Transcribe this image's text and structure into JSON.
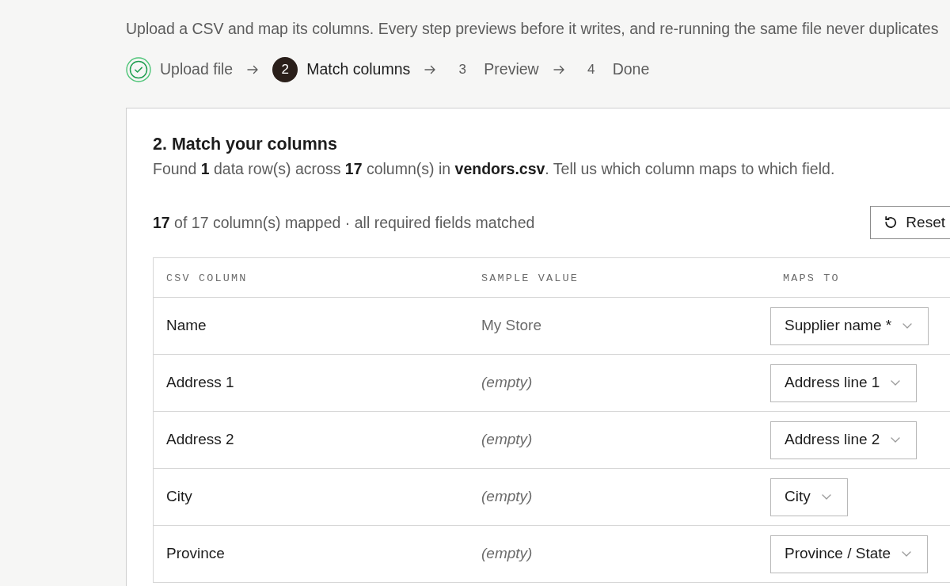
{
  "intro": "Upload a CSV and map its columns. Every step previews before it writes, and re-running the same file never duplicates",
  "steps": [
    {
      "label": "Upload file",
      "completed": true,
      "selected": false
    },
    {
      "number": "2",
      "label": "Match columns",
      "completed": false,
      "selected": true
    },
    {
      "number": "3",
      "label": "Preview",
      "completed": false,
      "selected": false
    },
    {
      "number": "4",
      "label": "Done",
      "completed": false,
      "selected": false
    }
  ],
  "card": {
    "heading": "2. Match your columns",
    "description": "Found **1** data row(s) across **17** column(s) in **vendors.csv**. Tell us which column maps to which field.",
    "summary": "**17** of 17 column(s) mapped · all required fields matched",
    "reset_button": {
      "label": "Reset"
    },
    "table": {
      "columns": [
        "CSV COLUMN",
        "SAMPLE VALUE",
        "MAPS TO"
      ],
      "rows": [
        {
          "column": "Name",
          "sample": "My Store",
          "sample_empty": false,
          "maps_to": "Supplier name *"
        },
        {
          "column": "Address 1",
          "sample": "(empty)",
          "sample_empty": true,
          "maps_to": "Address line 1"
        },
        {
          "column": "Address 2",
          "sample": "(empty)",
          "sample_empty": true,
          "maps_to": "Address line 2"
        },
        {
          "column": "City",
          "sample": "(empty)",
          "sample_empty": true,
          "maps_to": "City"
        },
        {
          "column": "Province",
          "sample": "(empty)",
          "sample_empty": true,
          "maps_to": "Province / State"
        }
      ]
    }
  }
}
